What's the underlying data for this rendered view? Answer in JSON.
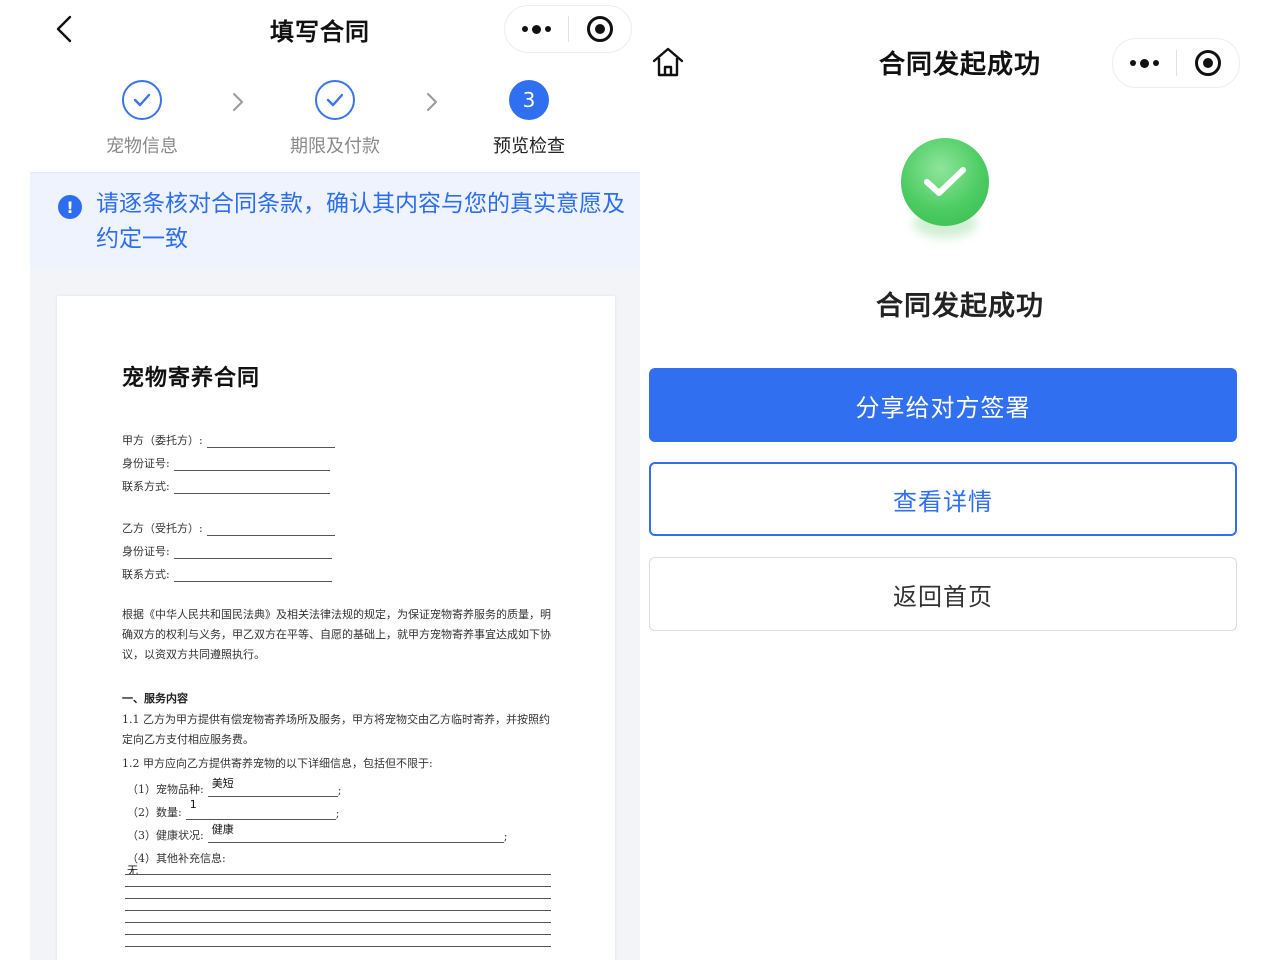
{
  "left": {
    "nav": {
      "title": "填写合同"
    },
    "steps": [
      {
        "label": "宠物信息",
        "status": "done"
      },
      {
        "label": "期限及付款",
        "status": "done"
      },
      {
        "label": "预览检查",
        "status": "active",
        "number": "3"
      }
    ],
    "notice": {
      "icon": "!",
      "text": "请逐条核对合同条款，确认其内容与您的真实意愿及约定一致"
    },
    "document": {
      "title": "宠物寄养合同",
      "party_a": {
        "label": "甲方（委托方）:",
        "id_label": "身份证号:",
        "contact_label": "联系方式:"
      },
      "party_b": {
        "label": "乙方（受托方）:",
        "id_label": "身份证号:",
        "contact_label": "联系方式:"
      },
      "intro": "根据《中华人民共和国民法典》及相关法律法规的规定，为保证宠物寄养服务的质量，明确双方的权利与义务，甲乙双方在平等、自愿的基础上，就甲方宠物寄养事宜达成如下协议，以资双方共同遵照执行。",
      "section1_title": "一、服务内容",
      "clause_1_1": "1.1 乙方为甲方提供有偿宠物寄养场所及服务，甲方将宠物交由乙方临时寄养，并按照约定向乙方支付相应服务费。",
      "clause_1_2": "1.2 甲方应向乙方提供寄养宠物的以下详细信息，包括但不限于:",
      "items": [
        {
          "label": "（1）宠物品种:",
          "value": "美短"
        },
        {
          "label": "（2）数量:",
          "value": "1"
        },
        {
          "label": "（3）健康状况:",
          "value": "健康"
        },
        {
          "label": "（4）其他补充信息:",
          "value": "无"
        }
      ],
      "semicolon": ";"
    }
  },
  "right": {
    "nav": {
      "title": "合同发起成功"
    },
    "success_title": "合同发起成功",
    "buttons": {
      "share": "分享给对方签署",
      "details": "查看详情",
      "home": "返回首页"
    }
  },
  "colors": {
    "primary": "#2f6ff0",
    "notice_bg": "#eef3fd",
    "success": "#4ccc63"
  }
}
